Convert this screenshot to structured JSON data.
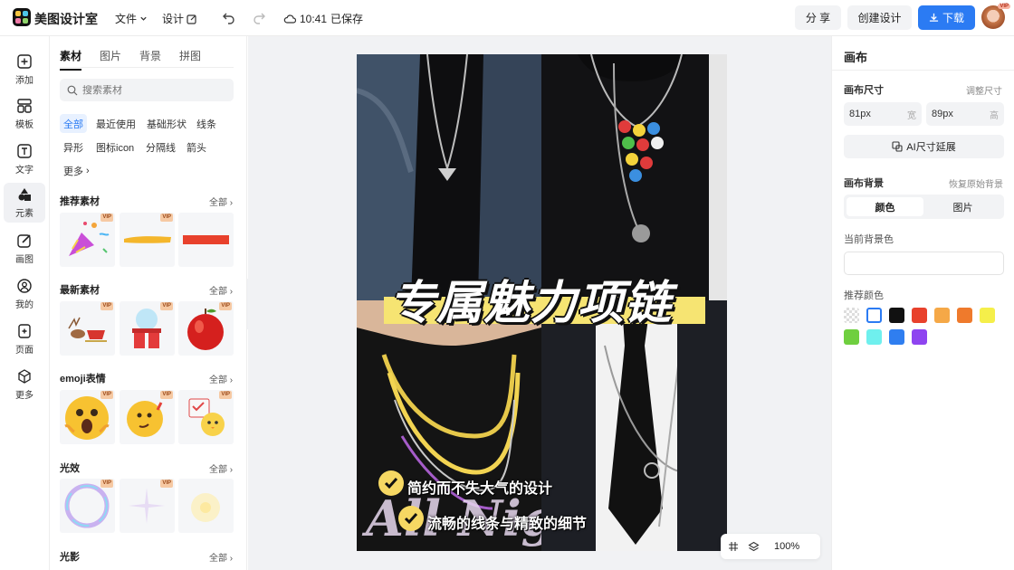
{
  "topbar": {
    "app_name": "美图设计室",
    "file_menu": "文件",
    "design_menu": "设计",
    "save_time": "10:41",
    "save_status": "已保存",
    "share_label": "分 享",
    "create_label": "创建设计",
    "download_label": "下载",
    "avatar_badge": "VIP"
  },
  "leftbar": {
    "items": [
      {
        "label": "添加",
        "icon": "plus-square-icon"
      },
      {
        "label": "模板",
        "icon": "template-icon"
      },
      {
        "label": "文字",
        "icon": "text-icon"
      },
      {
        "label": "元素",
        "icon": "shapes-icon"
      },
      {
        "label": "画图",
        "icon": "draw-icon"
      },
      {
        "label": "我的",
        "icon": "user-icon"
      },
      {
        "label": "页面",
        "icon": "page-add-icon"
      },
      {
        "label": "更多",
        "icon": "cube-icon"
      }
    ]
  },
  "panel": {
    "tabs": [
      "素材",
      "图片",
      "背景",
      "拼图"
    ],
    "search_placeholder": "搜索素材",
    "chips": [
      "全部",
      "最近使用",
      "基础形状",
      "线条",
      "异形",
      "图标icon",
      "分隔线",
      "箭头",
      "更多"
    ],
    "all_label": "全部",
    "vip_label": "VIP",
    "sections": [
      "推荐素材",
      "最新素材",
      "emoji表情",
      "光效",
      "光影"
    ]
  },
  "canvas": {
    "title": "专属魅力项链",
    "bullet1": "简约而不失大气的设计",
    "bullet2": "流畅的线条与精致的细节",
    "bg_script": "All Night",
    "zoom": "100%"
  },
  "right_panel": {
    "title": "画布",
    "size_label": "画布尺寸",
    "adjust_label": "调整尺寸",
    "width_value": "81px",
    "width_unit": "宽",
    "height_value": "89px",
    "height_unit": "高",
    "ai_extend": "AI尺寸延展",
    "bg_label": "画布背景",
    "restore_label": "恢复原始背景",
    "seg_color": "颜色",
    "seg_image": "图片",
    "current_bg_label": "当前背景色",
    "recommend_label": "推荐颜色",
    "colors": [
      "transparent",
      "#ffffff",
      "#111111",
      "#e8412c",
      "#f5a847",
      "#ef7a2c",
      "#f5ef4a",
      "#6fcf3f",
      "#6ff0ee",
      "#2f7ef0",
      "#8e44f0"
    ]
  }
}
